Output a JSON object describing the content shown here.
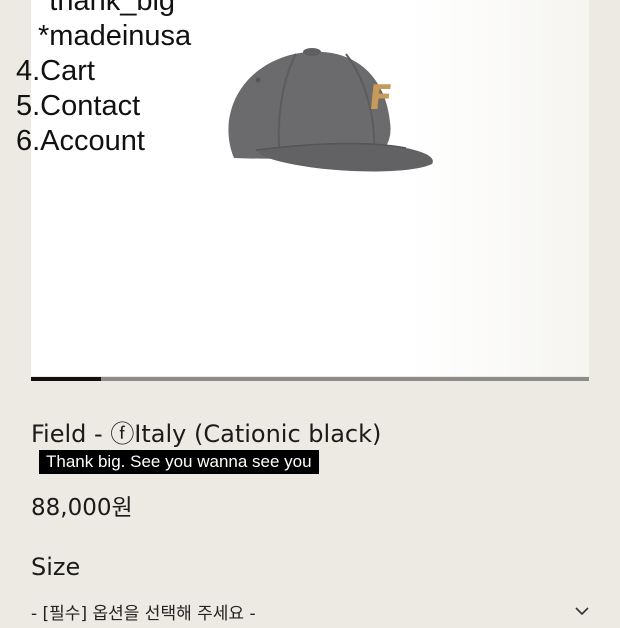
{
  "menu": {
    "items": [
      {
        "label": "*thank_big",
        "sub": true
      },
      {
        "label": "*madeinusa",
        "sub": true
      },
      {
        "label": "4.Cart",
        "sub": false
      },
      {
        "label": "5.Contact",
        "sub": false
      },
      {
        "label": "6.Account",
        "sub": false
      }
    ]
  },
  "image_slider": {
    "progress": 0.125
  },
  "product": {
    "title": "Field - ⓕItaly (Cationic black)",
    "tagline": "Thank big. See you wanna see you",
    "price": "88,000원",
    "cap_logo": "F"
  },
  "option": {
    "label": "Size",
    "placeholder": "- [필수] 옵션을 선택해 주세요 -",
    "chevron_icon": "chevron-down-icon"
  }
}
